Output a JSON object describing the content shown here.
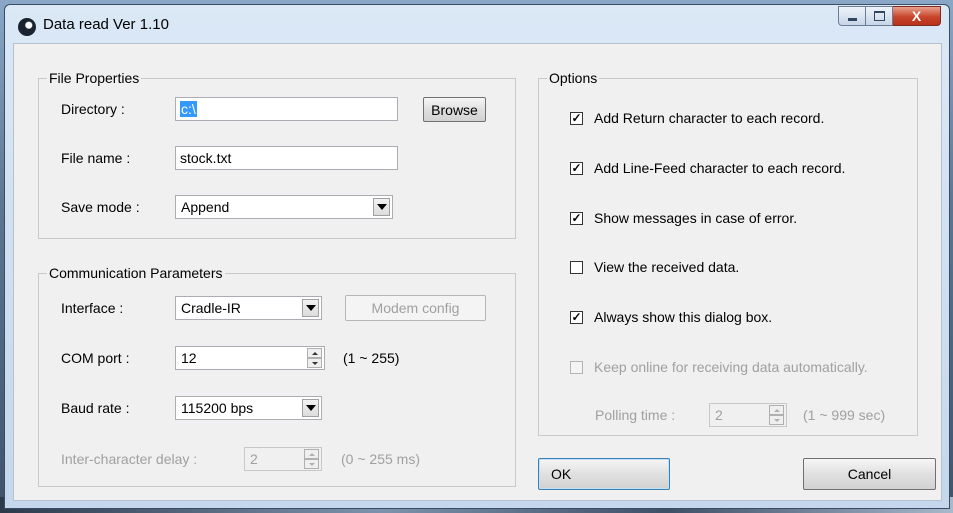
{
  "window": {
    "title": "Data read  Ver 1.10"
  },
  "file_properties": {
    "legend": "File Properties",
    "directory_label": "Directory :",
    "directory_value": "c:\\",
    "browse_button": "Browse",
    "filename_label": "File name :",
    "filename_value": "stock.txt",
    "savemode_label": "Save mode :",
    "savemode_value": "Append"
  },
  "comm": {
    "legend": "Communication Parameters",
    "interface_label": "Interface :",
    "interface_value": "Cradle-IR",
    "modem_button": "Modem config",
    "comport_label": "COM port :",
    "comport_value": "12",
    "comport_range": "(1 ~ 255)",
    "baud_label": "Baud rate :",
    "baud_value": "115200 bps",
    "delay_label": "Inter-character delay :",
    "delay_value": "2",
    "delay_range": "(0 ~ 255 ms)"
  },
  "options": {
    "legend": "Options",
    "items": [
      {
        "label": "Add Return character to each record.",
        "checked": true,
        "enabled": true
      },
      {
        "label": "Add Line-Feed character to each record.",
        "checked": true,
        "enabled": true
      },
      {
        "label": "Show messages in case of error.",
        "checked": true,
        "enabled": true
      },
      {
        "label": "View the received data.",
        "checked": false,
        "enabled": true
      },
      {
        "label": "Always show this dialog box.",
        "checked": true,
        "enabled": true
      },
      {
        "label": "Keep online for receiving data automatically.",
        "checked": false,
        "enabled": false
      }
    ],
    "polling_label": "Polling time :",
    "polling_value": "2",
    "polling_range": "(1 ~ 999 sec)"
  },
  "buttons": {
    "ok": "OK",
    "cancel": "Cancel"
  },
  "titlebar_buttons": {
    "close": "X"
  }
}
